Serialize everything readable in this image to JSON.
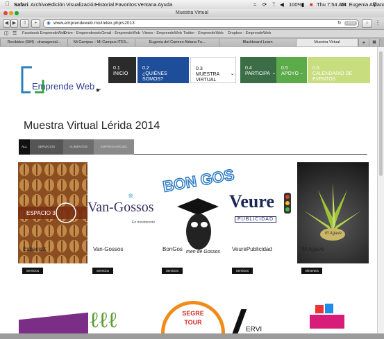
{
  "menubar": {
    "app": "Safari",
    "items": [
      "Archivo",
      "Edición",
      "Visualización",
      "Historial",
      "Favoritos",
      "Ventana",
      "Ayuda"
    ],
    "battery": "100%",
    "clock": "Thu 7:54 AM",
    "user": "Dr. Eugenia Aldana"
  },
  "window": {
    "title": "Muestra Virtual"
  },
  "toolbar": {
    "url": "www.emprendeweb.mx/index.php/s2013",
    "reader": "Lector"
  },
  "bookmarks": [
    "Facebook EmprendeWeb",
    "Drive - Emprendeweb",
    "Gmail - EmprendeWeb",
    "Vimeo - EmprendeWeb",
    "Twitter - EmprendeWeb",
    "Dropbox - EmprendeWeb"
  ],
  "tabs": [
    "Recibidos (984) - dranagenial...",
    "Mi Campus – Mi Campus ITES...",
    "Eugenia del Carmen Aldana Fu...",
    "Blackboard Learn",
    "Muestra Virtual"
  ],
  "site": {
    "logo_text": "Emprende Web",
    "nav": [
      {
        "num": "0.1",
        "label": "INICIO",
        "color": "#2b2b2b"
      },
      {
        "num": "0.2",
        "label": "¿QUIÉNES SOMOS?",
        "color": "#1e4d9a"
      },
      {
        "num": "0.3",
        "label": "MUESTRA VIRTUAL",
        "color": "#ffffff"
      },
      {
        "num": "0.4",
        "label": "PARTICIPA",
        "color": "#3b6e46"
      },
      {
        "num": "0.5",
        "label": "APOYO",
        "color": "#5bab4b"
      },
      {
        "num": "0.6",
        "label": "CALENDARIO DE EVENTOS",
        "color": "#c7dd7e"
      }
    ],
    "page_title": "Muestra Virtual Lérida 2014",
    "filters": [
      "ALL",
      "SERVICIOS",
      "ALIMENTOS",
      "EMPRESAS/ICIDS"
    ],
    "cards": [
      {
        "name": "Espacio3",
        "category": "Servicios",
        "art": "ESPACIO 3"
      },
      {
        "name": "Van-Gossos",
        "category": "Servicios",
        "art": "Van-Gossos",
        "art_sub": "En movimiento"
      },
      {
        "name": "BonGos",
        "category": "Servicios",
        "art": "BON GOS",
        "art_sub": "men de Gossos"
      },
      {
        "name": "VeurePublicidad",
        "category": "Servicios",
        "art": "Veure",
        "art_sub": "PUBLICIDAD"
      },
      {
        "name": "El Agave",
        "category": "Alimentos",
        "art": "El Agave"
      }
    ],
    "row2_art": [
      "SEGRE",
      "TOUR",
      "ERVI"
    ]
  }
}
